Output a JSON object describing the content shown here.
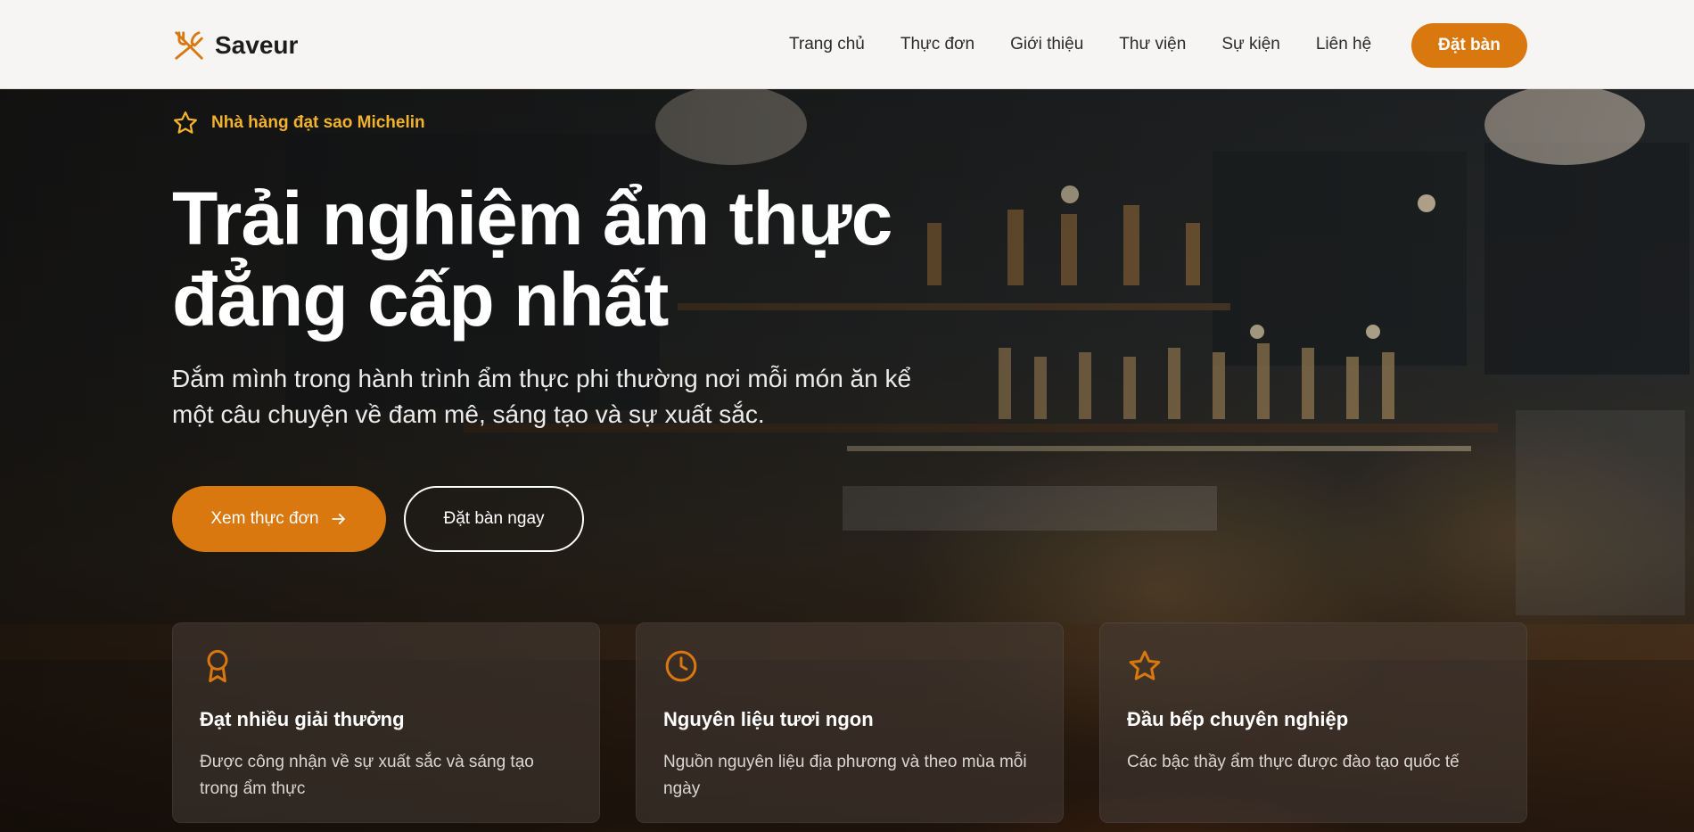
{
  "brand": {
    "name": "Saveur",
    "logo_icon": "utensils-icon",
    "accent": "#d9780f"
  },
  "nav": {
    "items": [
      "Trang chủ",
      "Thực đơn",
      "Giới thiệu",
      "Thư viện",
      "Sự kiện",
      "Liên hệ"
    ],
    "cta_label": "Đặt bàn"
  },
  "hero": {
    "badge_icon": "star-icon",
    "badge_text": "Nhà hàng đạt sao Michelin",
    "title_line1": "Trải nghiệm ẩm thực",
    "title_line2": "đẳng cấp nhất",
    "subtitle": "Đắm mình trong hành trình ẩm thực phi thường nơi mỗi món ăn kể một câu chuyện về đam mê, sáng tạo và sự xuất sắc.",
    "primary_button": "Xem thực đơn",
    "primary_button_icon": "arrow-right-icon",
    "secondary_button": "Đặt bàn ngay"
  },
  "features": [
    {
      "icon": "award-icon",
      "title": "Đạt nhiều giải thưởng",
      "description": "Được công nhận về sự xuất sắc và sáng tạo trong ẩm thực"
    },
    {
      "icon": "clock-icon",
      "title": "Nguyên liệu tươi ngon",
      "description": "Nguồn nguyên liệu địa phương và theo mùa mỗi ngày"
    },
    {
      "icon": "star-icon",
      "title": "Đầu bếp chuyên nghiệp",
      "description": "Các bậc thầy ẩm thực được đào tạo quốc tế"
    }
  ]
}
